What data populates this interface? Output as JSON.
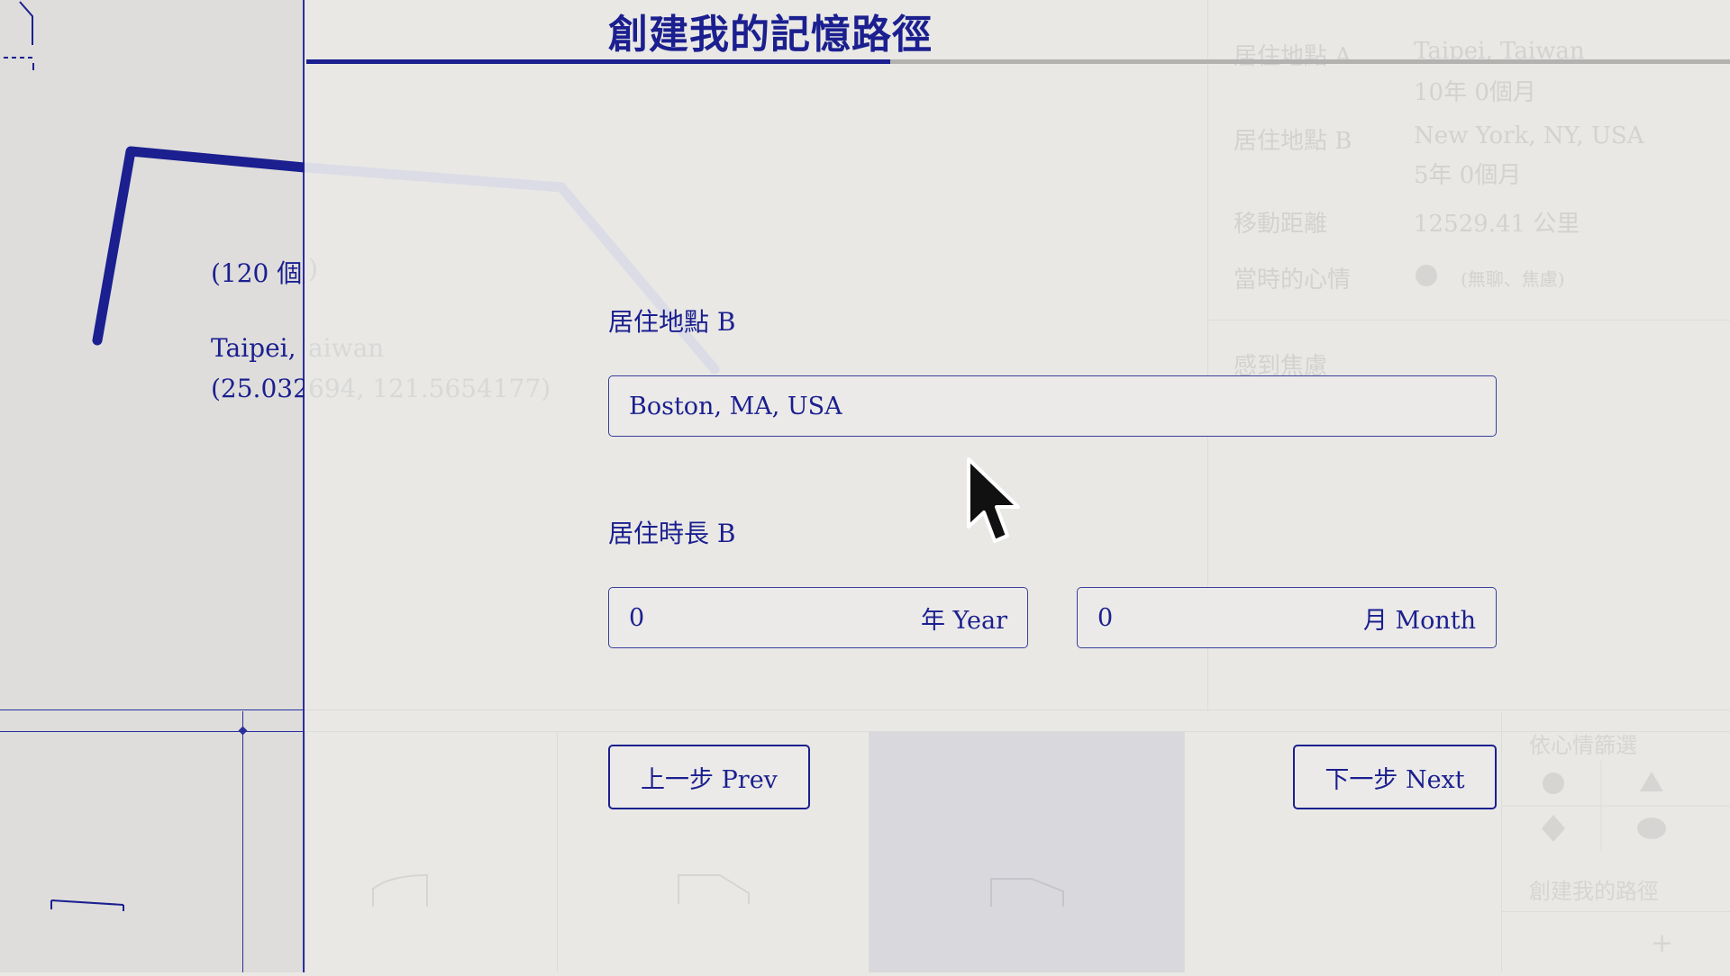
{
  "app": {
    "title": "創建我的記憶路徑",
    "progress_fraction": 0.41
  },
  "map_strip": {
    "count_text": "(120 個人)",
    "place_name": "Taipei, Taiwan",
    "coords": "(25.0329694, 121.5654177)"
  },
  "form": {
    "location_label": "居住地點 B",
    "location_value": "Boston, MA, USA",
    "duration_label": "居住時長 B",
    "years_value": "0",
    "years_unit": "年 Year",
    "months_value": "0",
    "months_unit": "月 Month",
    "prev_label": "上一步 Prev",
    "next_label": "下一步 Next"
  },
  "background_summary": {
    "rows": [
      {
        "label": "居住地點 A",
        "value": "Taipei, Taiwan",
        "sub": "10年 0個月"
      },
      {
        "label": "居住地點 B",
        "value": "New York, NY, USA",
        "sub": "5年 0個月"
      },
      {
        "label": "移動距離",
        "value": "12529.41 公里",
        "sub": ""
      },
      {
        "label": "當時的心情",
        "value": "(無聊、焦慮)",
        "sub": ""
      }
    ],
    "section_label": "感到焦慮",
    "mood_panel_title": "依心情篩選",
    "create_path_label": "創建我的路徑"
  },
  "colors": {
    "accent": "#1b1f8f",
    "background": "#e9e8e5",
    "track": "#b3b2b0"
  },
  "icons": [
    "cursor-arrow-icon"
  ]
}
